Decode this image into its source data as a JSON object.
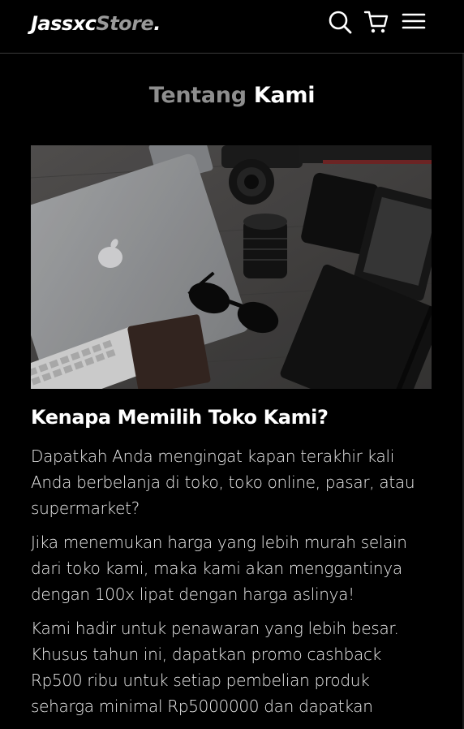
{
  "navbar": {
    "logo_main": "Jassxc",
    "logo_accent": "Store",
    "logo_dot": "."
  },
  "icons": {
    "search": "search-icon",
    "cart": "shopping-cart-icon",
    "menu": "hamburger-menu-icon"
  },
  "about": {
    "title_part1": "Tentang",
    "title_part2": "Kami",
    "subheading": "Kenapa Memilih Toko Kami?",
    "paragraphs": [
      "Dapatkah Anda mengingat kapan terakhir kali Anda berbelanja di toko, toko online, pasar, atau supermarket?",
      "Jika menemukan harga yang lebih murah selain dari toko kami, maka kami akan menggantinya dengan 100x lipat dengan harga aslinya!",
      "Kami hadir untuk penawaran yang lebih besar. Khusus tahun ini, dapatkan promo cashback Rp500 ribu untuk setiap pembelian produk seharga minimal Rp5000000 dan dapatkan"
    ]
  },
  "colors": {
    "background": "#000000",
    "text": "#ffffff",
    "muted": "#8e8e8e"
  }
}
